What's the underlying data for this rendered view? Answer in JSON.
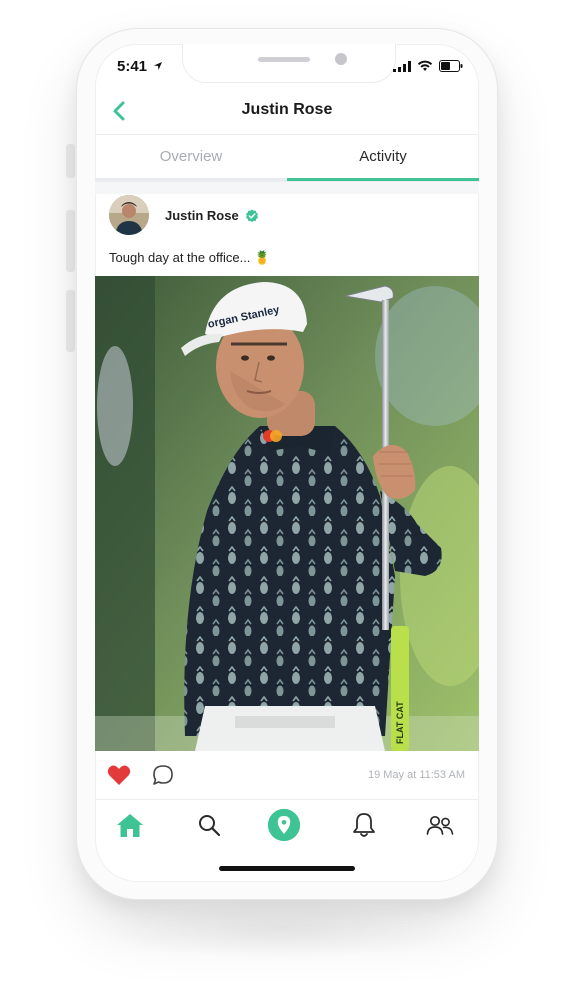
{
  "status_bar": {
    "time": "5:41"
  },
  "header": {
    "title": "Justin Rose"
  },
  "tabs": [
    {
      "label": "Overview",
      "active": false
    },
    {
      "label": "Activity",
      "active": true
    }
  ],
  "post": {
    "author": "Justin Rose",
    "caption": "Tough day at the office... 🍍",
    "photo_cap_text": "organ Stanley",
    "shaft_text": "FLAT CAT",
    "timestamp": "19 May at 11:53 AM"
  },
  "icons": {
    "back": "chevron-left-icon",
    "verified": "verified-badge-icon",
    "like": "heart-icon",
    "comment": "comment-bubble-icon",
    "home": "home-icon",
    "search": "search-icon",
    "location": "location-pin-icon",
    "notifications": "bell-icon",
    "people": "people-icon"
  },
  "colors": {
    "accent": "#3ec394",
    "like": "#e33b3b",
    "muted": "#a7acb2"
  }
}
